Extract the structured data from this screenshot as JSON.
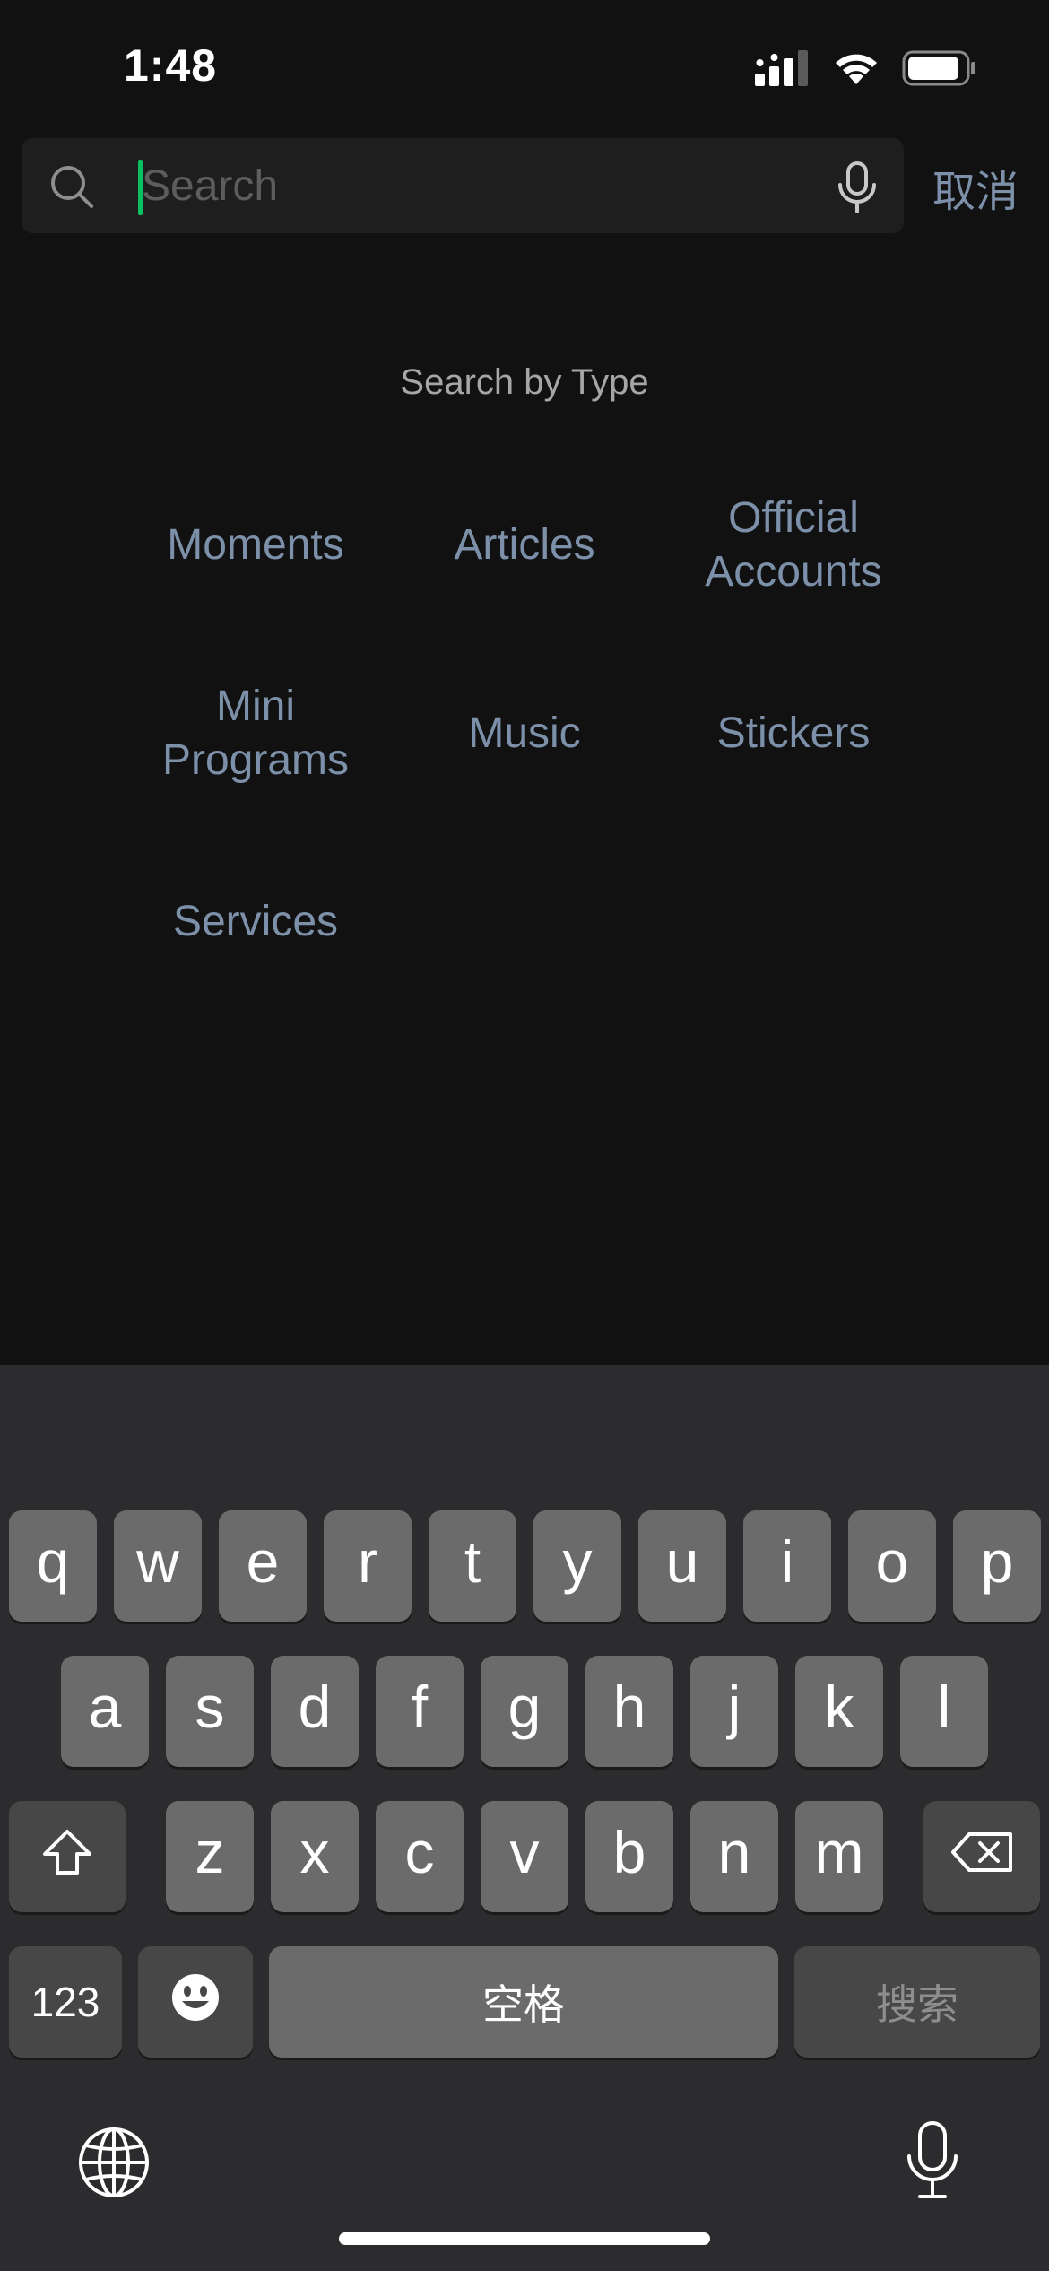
{
  "status_bar": {
    "time": "1:48"
  },
  "search": {
    "placeholder": "Search",
    "value": "",
    "cancel_label": "取消"
  },
  "search_by_type": {
    "title": "Search by Type",
    "items": [
      {
        "label": "Moments"
      },
      {
        "label": "Articles"
      },
      {
        "label": "Official\nAccounts"
      },
      {
        "label": "Mini\nPrograms"
      },
      {
        "label": "Music"
      },
      {
        "label": "Stickers"
      },
      {
        "label": "Services"
      }
    ]
  },
  "keyboard": {
    "row1": [
      "q",
      "w",
      "e",
      "r",
      "t",
      "y",
      "u",
      "i",
      "o",
      "p"
    ],
    "row2": [
      "a",
      "s",
      "d",
      "f",
      "g",
      "h",
      "j",
      "k",
      "l"
    ],
    "row3": [
      "z",
      "x",
      "c",
      "v",
      "b",
      "n",
      "m"
    ],
    "numbers_label": "123",
    "space_label": "空格",
    "search_label": "搜索"
  },
  "colors": {
    "background": "#111111",
    "accent_green": "#07c160",
    "link_blue": "#7d90a9",
    "keyboard_bg": "#2c2c2e",
    "key_bg": "#6b6b6b",
    "key_fn_bg": "#474747"
  },
  "icons": {
    "signal": "cellular-signal-icon",
    "wifi": "wifi-icon",
    "battery": "battery-icon",
    "search": "search-icon",
    "mic": "microphone-icon",
    "shift": "shift-icon",
    "backspace": "backspace-icon",
    "emoji": "emoji-icon",
    "globe": "globe-icon"
  }
}
